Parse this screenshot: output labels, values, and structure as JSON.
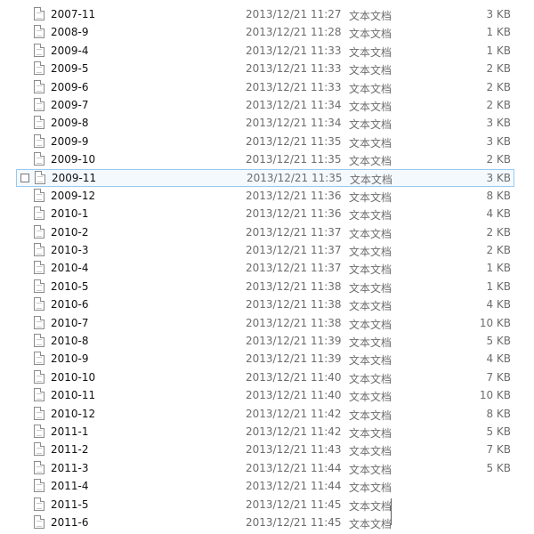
{
  "files": [
    {
      "name": "2007-11",
      "modified": "2013/12/21 11:27",
      "type": "文本文档",
      "size": "3 KB"
    },
    {
      "name": "2008-9",
      "modified": "2013/12/21 11:28",
      "type": "文本文档",
      "size": "1 KB"
    },
    {
      "name": "2009-4",
      "modified": "2013/12/21 11:33",
      "type": "文本文档",
      "size": "1 KB"
    },
    {
      "name": "2009-5",
      "modified": "2013/12/21 11:33",
      "type": "文本文档",
      "size": "2 KB"
    },
    {
      "name": "2009-6",
      "modified": "2013/12/21 11:33",
      "type": "文本文档",
      "size": "2 KB"
    },
    {
      "name": "2009-7",
      "modified": "2013/12/21 11:34",
      "type": "文本文档",
      "size": "2 KB"
    },
    {
      "name": "2009-8",
      "modified": "2013/12/21 11:34",
      "type": "文本文档",
      "size": "3 KB"
    },
    {
      "name": "2009-9",
      "modified": "2013/12/21 11:35",
      "type": "文本文档",
      "size": "3 KB"
    },
    {
      "name": "2009-10",
      "modified": "2013/12/21 11:35",
      "type": "文本文档",
      "size": "2 KB"
    },
    {
      "name": "2009-11",
      "modified": "2013/12/21 11:35",
      "type": "文本文档",
      "size": "3 KB",
      "selected": true
    },
    {
      "name": "2009-12",
      "modified": "2013/12/21 11:36",
      "type": "文本文档",
      "size": "8 KB"
    },
    {
      "name": "2010-1",
      "modified": "2013/12/21 11:36",
      "type": "文本文档",
      "size": "4 KB"
    },
    {
      "name": "2010-2",
      "modified": "2013/12/21 11:37",
      "type": "文本文档",
      "size": "2 KB"
    },
    {
      "name": "2010-3",
      "modified": "2013/12/21 11:37",
      "type": "文本文档",
      "size": "2 KB"
    },
    {
      "name": "2010-4",
      "modified": "2013/12/21 11:37",
      "type": "文本文档",
      "size": "1 KB"
    },
    {
      "name": "2010-5",
      "modified": "2013/12/21 11:38",
      "type": "文本文档",
      "size": "1 KB"
    },
    {
      "name": "2010-6",
      "modified": "2013/12/21 11:38",
      "type": "文本文档",
      "size": "4 KB"
    },
    {
      "name": "2010-7",
      "modified": "2013/12/21 11:38",
      "type": "文本文档",
      "size": "10 KB"
    },
    {
      "name": "2010-8",
      "modified": "2013/12/21 11:39",
      "type": "文本文档",
      "size": "5 KB"
    },
    {
      "name": "2010-9",
      "modified": "2013/12/21 11:39",
      "type": "文本文档",
      "size": "4 KB"
    },
    {
      "name": "2010-10",
      "modified": "2013/12/21 11:40",
      "type": "文本文档",
      "size": "7 KB"
    },
    {
      "name": "2010-11",
      "modified": "2013/12/21 11:40",
      "type": "文本文档",
      "size": "10 KB"
    },
    {
      "name": "2010-12",
      "modified": "2013/12/21 11:42",
      "type": "文本文档",
      "size": "8 KB"
    },
    {
      "name": "2011-1",
      "modified": "2013/12/21 11:42",
      "type": "文本文档",
      "size": "5 KB"
    },
    {
      "name": "2011-2",
      "modified": "2013/12/21 11:43",
      "type": "文本文档",
      "size": "7 KB"
    },
    {
      "name": "2011-3",
      "modified": "2013/12/21 11:44",
      "type": "文本文档",
      "size": "5 KB"
    },
    {
      "name": "2011-4",
      "modified": "2013/12/21 11:44",
      "type": "文本文档",
      "size": ""
    },
    {
      "name": "2011-5",
      "modified": "2013/12/21 11:45",
      "type": "文本文档",
      "size": ""
    },
    {
      "name": "2011-6",
      "modified": "2013/12/21 11:45",
      "type": "文本文档",
      "size": ""
    }
  ],
  "colors": {
    "selection_background": "#f4f9fe",
    "selection_border": "#99c9ef",
    "secondary_text": "#6d6d6d"
  },
  "icons": {
    "file": "text-document-icon",
    "checkbox": "checkbox-icon"
  }
}
